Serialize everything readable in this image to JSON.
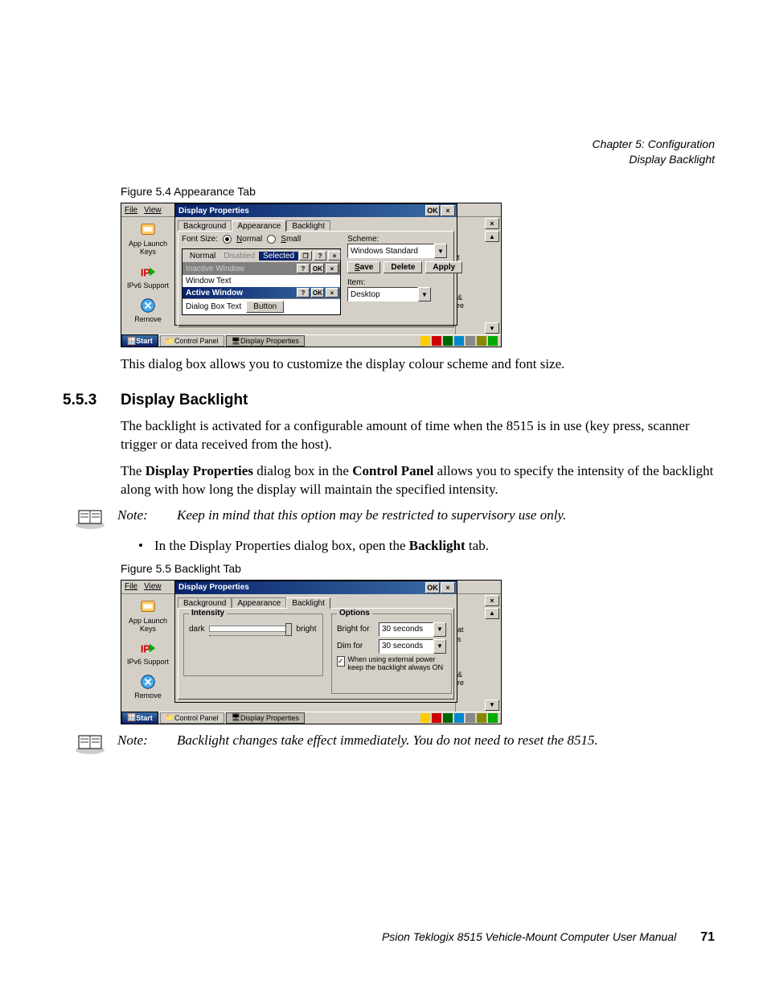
{
  "header": {
    "chapter": "Chapter 5: Configuration",
    "section": "Display Backlight"
  },
  "fig1": {
    "caption": "Figure 5.4  Appearance Tab",
    "menubar": {
      "file": "File",
      "view": "View"
    },
    "dialog_title": "Display Properties",
    "ok": "OK",
    "x": "×",
    "tabs": {
      "background": "Background",
      "appearance": "Appearance",
      "backlight": "Backlight"
    },
    "font_size_label": "Font Size:",
    "radio_normal": "Normal",
    "radio_small": "Small",
    "preview": {
      "state_normal": "Normal",
      "state_disabled": "Disabled",
      "state_selected": "Selected",
      "inactive": "Inactive Window",
      "window_text": "Window Text",
      "active": "Active Window",
      "dialog_text": "Dialog Box Text",
      "button": "Button",
      "q": "?",
      "ok": "OK",
      "x": "×"
    },
    "scheme_label": "Scheme:",
    "scheme_value": "Windows Standard",
    "save": "Save",
    "delete": "Delete",
    "apply": "Apply",
    "item_label": "Item:",
    "item_value": "Desktop",
    "sidebar": {
      "i1": "App Launch Keys",
      "i2": "IPv6 Support",
      "i3": "Remove"
    },
    "rightpanel": {
      "stub1": "t",
      "stub2": "&",
      "stub3": "re"
    },
    "taskbar": {
      "start": "Start",
      "task1": "Control Panel",
      "task2": "Display Properties"
    }
  },
  "para1": "This dialog box allows you to customize the display colour scheme and font size.",
  "heading": {
    "num": "5.5.3",
    "title": "Display Backlight"
  },
  "para2": "The backlight is activated for a configurable amount of time when the 8515 is in use (key press, scanner trigger or data received from the host).",
  "para3_pre": "The ",
  "para3_b1": "Display Properties",
  "para3_mid1": " dialog box in the ",
  "para3_b2": "Control Panel",
  "para3_post": " allows you to specify the intensity of the backlight along with how long the display will maintain the specified intensity.",
  "note1": {
    "label": "Note:",
    "text": "Keep in mind that this option may be restricted to supervisory use only."
  },
  "bullet1_pre": "In the Display Properties dialog box, open the ",
  "bullet1_b": "Backlight",
  "bullet1_post": " tab.",
  "fig2": {
    "caption": "Figure 5.5  Backlight Tab",
    "menubar": {
      "file": "File",
      "view": "View"
    },
    "dialog_title": "Display Properties",
    "ok": "OK",
    "x": "×",
    "tabs": {
      "background": "Background",
      "appearance": "Appearance",
      "backlight": "Backlight"
    },
    "intensity_legend": "Intensity",
    "dark": "dark",
    "bright": "bright",
    "options_legend": "Options",
    "bright_for": "Bright for",
    "dim_for": "Dim for",
    "thirty": "30 seconds",
    "external_power": "When using external power keep the backlight always ON",
    "sidebar": {
      "i1": "App Launch Keys",
      "i2": "IPv6 Support",
      "i3": "Remove"
    },
    "rightpanel": {
      "stub1": "at",
      "stub2": "s",
      "stub3": "&",
      "stub4": "re"
    },
    "taskbar": {
      "start": "Start",
      "task1": "Control Panel",
      "task2": "Display Properties"
    }
  },
  "note2": {
    "label": "Note:",
    "text": "Backlight changes take effect immediately. You do not need to reset the 8515."
  },
  "footer": {
    "text": "Psion Teklogix 8515 Vehicle-Mount Computer User Manual",
    "page": "71"
  }
}
